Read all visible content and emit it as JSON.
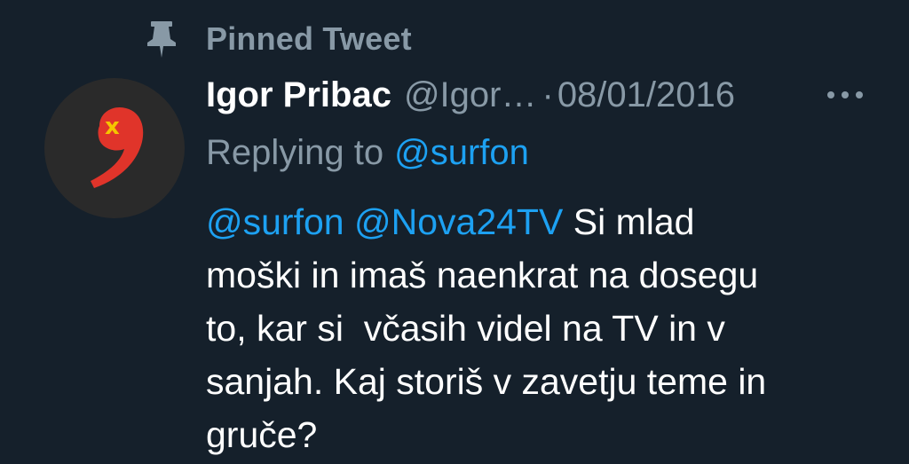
{
  "pinned": {
    "label": "Pinned Tweet",
    "icon": "pin-icon"
  },
  "tweet": {
    "author": {
      "display_name": "Igor Pribac",
      "handle": "@Igor…",
      "avatar_icon": "comma-logo-icon"
    },
    "separator": "·",
    "date": "08/01/2016",
    "more_icon": "more-dots-icon",
    "reply": {
      "prefix": "Replying to",
      "mention": "@surfon"
    },
    "body": {
      "mention_1": "@surfon",
      "mention_2": "@Nova24TV",
      "line_1_rest": " Si mlad",
      "line_2": "moški in imaš naenkrat na dosegu",
      "line_3": "to, kar si  včasih videl na TV in v",
      "line_4": "sanjah. Kaj storiš v zavetju teme in",
      "line_5": "gruče?"
    }
  },
  "colors": {
    "background": "#15202b",
    "primary_text": "#ffffff",
    "secondary_text": "#8899a6",
    "link": "#1da1f2",
    "avatar_bg": "#2a2a2a",
    "logo_red": "#e0342a",
    "logo_yellow": "#f5c400"
  }
}
